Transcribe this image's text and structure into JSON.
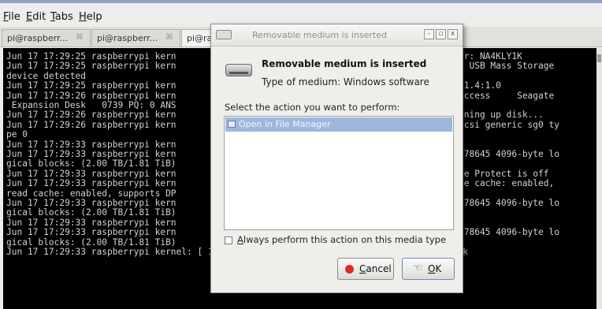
{
  "menu": {
    "file": {
      "acc": "F",
      "rest": "ile"
    },
    "edit": {
      "acc": "E",
      "rest": "dit"
    },
    "tabs": {
      "acc": "T",
      "rest": "abs"
    },
    "help": {
      "acc": "H",
      "rest": "elp"
    }
  },
  "tabs": [
    {
      "label": "pi@raspberr..."
    },
    {
      "label": "pi@raspberr..."
    },
    {
      "label": "pi@ra"
    }
  ],
  "tab_close_glyph": "⌘",
  "terminal": {
    "left_lines": [
      "Jun 17 17:29:25 raspberrypi kern",
      "Jun 17 17:29:25 raspberrypi kern",
      "device detected",
      "Jun 17 17:29:25 raspberrypi kern",
      "Jun 17 17:29:26 raspberrypi kern",
      " Expansion Desk   0739 PQ: 0 ANS",
      "Jun 17 17:29:26 raspberrypi kern",
      "Jun 17 17:29:26 raspberrypi kern",
      "pe 0",
      "Jun 17 17:29:33 raspberrypi kern",
      "Jun 17 17:29:33 raspberrypi kern",
      "gical blocks: (2.00 TB/1.81 TiB)",
      "Jun 17 17:29:33 raspberrypi kern",
      "Jun 17 17:29:33 raspberrypi kern",
      "read cache: enabled, supports DP",
      "Jun 17 17:29:33 raspberrypi kern",
      "gical blocks: (2.00 TB/1.81 TiB)",
      "Jun 17 17:29:33 raspberrypi kern",
      "Jun 17 17:29:33 raspberrypi kern",
      "gical blocks: (2.00 TB/1.81 TiB)",
      "Jun 17 17:29:33 raspberrypi kernel: [ 1180.447720] sd 0:0:0:0: [sda] Attached SCSI disk"
    ],
    "right_lines": [
      {
        "row": 0,
        "text": "er: NA4KLY1K"
      },
      {
        "row": 1,
        "text": ": USB Mass Storage"
      },
      {
        "row": 3,
        "text": "-1.4:1.0"
      },
      {
        "row": 4,
        "text": "Access     Seagate"
      },
      {
        "row": 6,
        "text": "nning up disk..."
      },
      {
        "row": 7,
        "text": "scsi generic sg0 ty"
      },
      {
        "row": 10,
        "text": "378645 4096-byte lo"
      },
      {
        "row": 12,
        "text": "te Protect is off"
      },
      {
        "row": 13,
        "text": "te cache: enabled,"
      },
      {
        "row": 15,
        "text": "378645 4096-byte lo"
      },
      {
        "row": 18,
        "text": "378645 4096-byte lo"
      }
    ]
  },
  "dialog": {
    "title": "Removable medium is inserted",
    "heading": "Removable medium is inserted",
    "medium_text": "Type of medium:  Windows software",
    "prompt": "Select the action you want to perform:",
    "action_item": "Open in File Manager",
    "always": {
      "acc": "A",
      "rest": "lways perform this action on this media type"
    },
    "cancel": {
      "acc": "C",
      "rest": "ancel"
    },
    "ok": {
      "acc": "O",
      "rest": "K"
    },
    "win_min": "-",
    "win_max": "▫",
    "win_close": "x"
  },
  "colors": {
    "selection": "#9db7df",
    "terminal_bg": "#000000",
    "cancel_icon": "#e02a1f"
  }
}
